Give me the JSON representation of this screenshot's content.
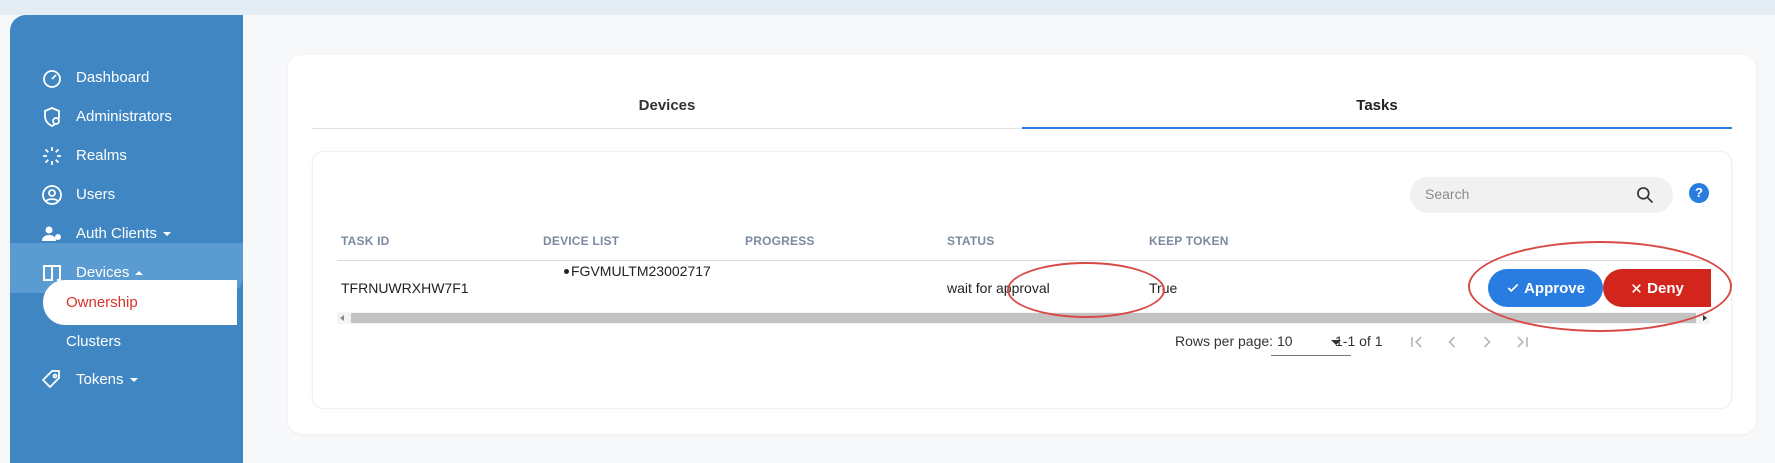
{
  "sidebar": {
    "items": [
      {
        "label": "Dashboard",
        "icon": "dashboard-gauge-icon"
      },
      {
        "label": "Administrators",
        "icon": "shield-user-icon"
      },
      {
        "label": "Realms",
        "icon": "realms-sparkle-icon"
      },
      {
        "label": "Users",
        "icon": "user-circle-icon"
      },
      {
        "label": "Auth Clients",
        "icon": "auth-clients-icon"
      },
      {
        "label": "Devices",
        "icon": "devices-icon"
      },
      {
        "label": "Ownership"
      },
      {
        "label": "Clusters"
      },
      {
        "label": "Tokens",
        "icon": "tokens-tag-icon"
      }
    ]
  },
  "tabs": [
    {
      "label": "Devices"
    },
    {
      "label": "Tasks"
    }
  ],
  "search": {
    "placeholder": "Search"
  },
  "help_label": "?",
  "table": {
    "headers": [
      "TASK ID",
      "DEVICE LIST",
      "PROGRESS",
      "STATUS",
      "KEEP TOKEN"
    ],
    "rows": [
      {
        "task_id": "TFRNUWRXHW7F1",
        "device_list": [
          "FGVMULTM23002717"
        ],
        "progress": "",
        "status": "wait for approval",
        "keep_token": "True",
        "approve_label": "Approve",
        "deny_label": "Deny"
      }
    ]
  },
  "pagination": {
    "rows_per_page_label": "Rows per page:",
    "rows_per_page": "10",
    "range": "1-1 of 1"
  },
  "colors": {
    "sidebar": "#4086c2",
    "accent": "#2a7de0",
    "deny": "#d2261d",
    "active_sub": "#d9342b",
    "annotation_ring": "#d84a45"
  }
}
